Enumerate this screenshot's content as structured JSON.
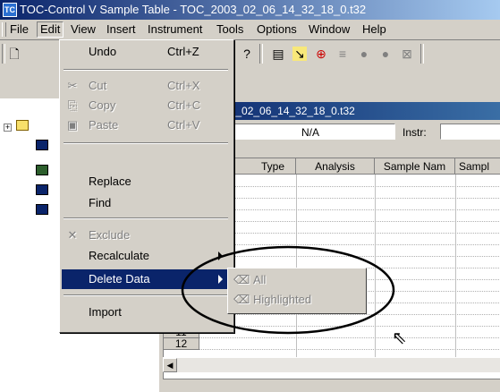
{
  "window": {
    "title": "TOC-Control V  Sample Table - TOC_2003_02_06_14_32_18_0.t32"
  },
  "menubar": [
    "File",
    "Edit",
    "View",
    "Insert",
    "Instrument",
    "Tools",
    "Options",
    "Window",
    "Help"
  ],
  "toolbar": {
    "icons": [
      "new-file-icon",
      "help-icon",
      "table-icon",
      "pointer-icon",
      "target-icon",
      "flag-icon",
      "stop-icon",
      "stop2-icon",
      "exclude-icon"
    ]
  },
  "child": {
    "title": "03_02_06_14_32_18_0.t32",
    "info_value": "N/A",
    "info_label": "Instr:",
    "columns": [
      "Type",
      "Analysis",
      "Sample Nam",
      "Sampl"
    ],
    "rows": [
      "11",
      "12"
    ]
  },
  "edit_menu": {
    "items": [
      {
        "label": "Undo",
        "shortcut": "Ctrl+Z",
        "disabled": false
      },
      {
        "label": "Cut",
        "shortcut": "Ctrl+X",
        "disabled": true
      },
      {
        "label": "Copy",
        "shortcut": "Ctrl+C",
        "disabled": true
      },
      {
        "label": "Paste",
        "shortcut": "Ctrl+V",
        "disabled": true
      },
      {
        "label": "Replace",
        "shortcut": "",
        "disabled": false
      },
      {
        "label": "Find",
        "shortcut": "",
        "disabled": false
      },
      {
        "label": "Exclude",
        "shortcut": "",
        "disabled": true
      },
      {
        "label": "Recalculate",
        "shortcut": "",
        "disabled": false
      },
      {
        "label": "Delete Data",
        "shortcut": "",
        "disabled": false
      },
      {
        "label": "Import",
        "shortcut": "",
        "disabled": false
      }
    ]
  },
  "submenu": {
    "items": [
      "All",
      "Highlighted"
    ]
  },
  "colors": {
    "titlebar": "#0a246a",
    "highlight": "#0a246a",
    "face": "#d4d0c8"
  }
}
